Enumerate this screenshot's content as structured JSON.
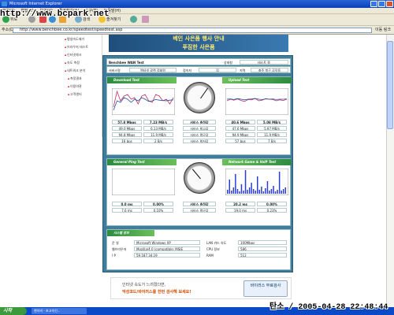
{
  "window": {
    "title": "Microsoft Internet Explorer",
    "title_suffix": "- Microsoft Internet Explorer"
  },
  "menu": [
    "파일(F)",
    "편집(E)",
    "보기(V)",
    "즐겨찾기(A)",
    "도구(T)",
    "도움말(H)"
  ],
  "toolbar": {
    "back_label": "뒤로",
    "search_label": "검색",
    "favorites_label": "즐겨찾기"
  },
  "address": {
    "label": "주소(D)",
    "url": "http://www.benchbee.co.kr/speedtest/speedtest.asp",
    "go_label": "이동",
    "links_label": "링크"
  },
  "watermark": "http://www.bcpark.net",
  "stamp": "탄소 / 2005-04-28 22:48:44",
  "nav": {
    "items": [
      "평생속도재기",
      "브라우저 테스트",
      "인터넷체크",
      "속도 측정",
      "네트워크 분석",
      "측정결과",
      "이용약관",
      "고객센터",
      "도움말"
    ]
  },
  "banner": {
    "line1": "베인 사은품 행사 안내",
    "line2": "푸짐한 사은품"
  },
  "test": {
    "title": "Benchbee WAN Test",
    "status_label": "상태창",
    "status_value": "테스트 중",
    "service_label": "서비스명",
    "service_value": "엔터넷 광랜 정회원",
    "region_label": "접속지",
    "region_value": "집",
    "area_label": "지역",
    "area_value": "충주 북구 공덕동"
  },
  "download": {
    "header": "Download Test",
    "row1": [
      "57.8 Mbps",
      "7.23 MB/s"
    ],
    "row2": [
      "49.0 Mbps",
      "6.13 MB/s"
    ],
    "row3": [
      "94.8 Mbps",
      "11.9 MB/s"
    ],
    "row4": [
      "16 bps",
      "2 B/s"
    ]
  },
  "upload": {
    "header": "Upload Test",
    "row1": [
      "40.6 Mbps",
      "5.08 MB/s"
    ],
    "row2": [
      "47.6 Mbps",
      "5.97 MB/s"
    ],
    "row3": [
      "94.9 Mbps",
      "11.9 MB/s"
    ],
    "row4": [
      "57 bps",
      "7 B/s"
    ]
  },
  "mid_labels": [
    "서비스 측정값",
    "서비스 최고값",
    "서비스 평균값",
    "서비스 최저값"
  ],
  "mid_labels2": [
    "서비스 측정값",
    "서비스 평균값"
  ],
  "ping": {
    "header": "General Ping Test",
    "val1": "0.0 ms",
    "val2": "0.00%",
    "val3": "7.6 ms",
    "val4": "0.10%"
  },
  "voip": {
    "header": "Network Game & VoIP Test",
    "val1": "20.2 ms",
    "val2": "0.00%",
    "val3": "19.0 ms",
    "val4": "0.23%"
  },
  "sysinfo": {
    "header": "시스템 정보",
    "os_label": "운 영",
    "os_value": "Microsoft Windows XP",
    "browser_label": "웹브라우저",
    "browser_value": "Mozilla/4.0 (compatible; MSIE",
    "ip_label": "I P",
    "ip_value": "59.187.34.19",
    "lan_label": "LAN 카드 속도",
    "lan_value": "100Mbps",
    "cpu_label": "CPU 정보",
    "cpu_value": "586",
    "ram_label": "RAM",
    "ram_value": "512"
  },
  "bottom_banner": {
    "line1": "인터넷 속도가 느려졌다면,",
    "line2": "악성코드/바이러스를 한번 검사해 보세요!",
    "cta": "바이러스 무료검사"
  },
  "taskbar": {
    "start": "시작",
    "task": "벤치비 - 초고속인..."
  },
  "chart_data": [
    {
      "type": "line",
      "title": "Download",
      "series": [
        {
          "values": [
            20,
            70,
            40,
            55,
            60,
            45,
            50,
            30,
            55,
            60,
            40,
            35,
            60,
            55,
            40,
            45,
            30,
            50
          ]
        },
        {
          "values": [
            10,
            40,
            35,
            50,
            45,
            35,
            45,
            40,
            50,
            45,
            38,
            40,
            44,
            42,
            41,
            40,
            42,
            43
          ]
        }
      ]
    },
    {
      "type": "line",
      "title": "Upload",
      "series": [
        {
          "values": [
            40,
            45,
            42,
            46,
            41,
            38,
            44,
            43,
            48,
            40,
            42,
            47,
            45,
            44,
            40,
            43,
            41,
            45
          ]
        },
        {
          "values": [
            45,
            46,
            44,
            47,
            45,
            43,
            45,
            46,
            47,
            45,
            44,
            46,
            45,
            46,
            44,
            45,
            45,
            46
          ]
        }
      ]
    },
    {
      "type": "bar",
      "title": "VoIP",
      "values": [
        5,
        18,
        4,
        8,
        25,
        6,
        3,
        12,
        4,
        30,
        5,
        8,
        14,
        6,
        4,
        22,
        5,
        9,
        3,
        7,
        16,
        4,
        6,
        10,
        3,
        5,
        28,
        4,
        6,
        8
      ]
    }
  ]
}
